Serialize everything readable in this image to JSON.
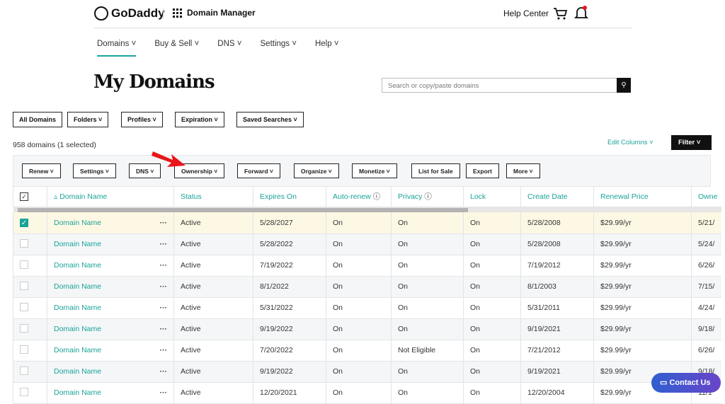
{
  "header": {
    "brand": "GoDaddy",
    "app": "Domain Manager",
    "help": "Help Center"
  },
  "nav": [
    "Domains",
    "Buy & Sell",
    "DNS",
    "Settings",
    "Help"
  ],
  "title": "My Domains",
  "search": {
    "placeholder": "Search or copy/paste domains"
  },
  "filters": [
    "All Domains",
    "Folders",
    "Profiles",
    "Expiration",
    "Saved Searches"
  ],
  "count": "958 domains (1 selected)",
  "edit_columns": "Edit Columns",
  "filter": "Filter",
  "toolbar": [
    "Renew",
    "Settings",
    "DNS",
    "Ownership",
    "Forward",
    "Organize",
    "Monetize",
    "List for Sale",
    "Export",
    "More"
  ],
  "columns": [
    "Domain Name",
    "Status",
    "Expires On",
    "Auto-renew",
    "Privacy",
    "Lock",
    "Create Date",
    "Renewal Price",
    "Owne"
  ],
  "rows": [
    [
      "Domain Name",
      "Active",
      "5/28/2027",
      "On",
      "On",
      "On",
      "5/28/2008",
      "$29.99/yr",
      "5/21/"
    ],
    [
      "Domain Name",
      "Active",
      "5/28/2022",
      "On",
      "On",
      "On",
      "5/28/2008",
      "$29.99/yr",
      "5/24/"
    ],
    [
      "Domain Name",
      "Active",
      "7/19/2022",
      "On",
      "On",
      "On",
      "7/19/2012",
      "$29.99/yr",
      "6/26/"
    ],
    [
      "Domain Name",
      "Active",
      "8/1/2022",
      "On",
      "On",
      "On",
      "8/1/2003",
      "$29.99/yr",
      "7/15/"
    ],
    [
      "Domain Name",
      "Active",
      "5/31/2022",
      "On",
      "On",
      "On",
      "5/31/2011",
      "$29.99/yr",
      "4/24/"
    ],
    [
      "Domain Name",
      "Active",
      "9/19/2022",
      "On",
      "On",
      "On",
      "9/19/2021",
      "$29.99/yr",
      "9/18/"
    ],
    [
      "Domain Name",
      "Active",
      "7/20/2022",
      "On",
      "Not Eligible",
      "On",
      "7/21/2012",
      "$29.99/yr",
      "6/26/"
    ],
    [
      "Domain Name",
      "Active",
      "9/19/2022",
      "On",
      "On",
      "On",
      "9/19/2021",
      "$29.99/yr",
      "9/18/"
    ],
    [
      "Domain Name",
      "Active",
      "12/20/2021",
      "On",
      "On",
      "On",
      "12/20/2004",
      "$29.99/yr",
      "11/1"
    ]
  ],
  "selected_rows": [
    0
  ],
  "contact": "Contact Us",
  "colors": {
    "accent": "#1aa39a",
    "selected_row": "#fdf8e4",
    "annotation_arrow": "#e8161b"
  }
}
